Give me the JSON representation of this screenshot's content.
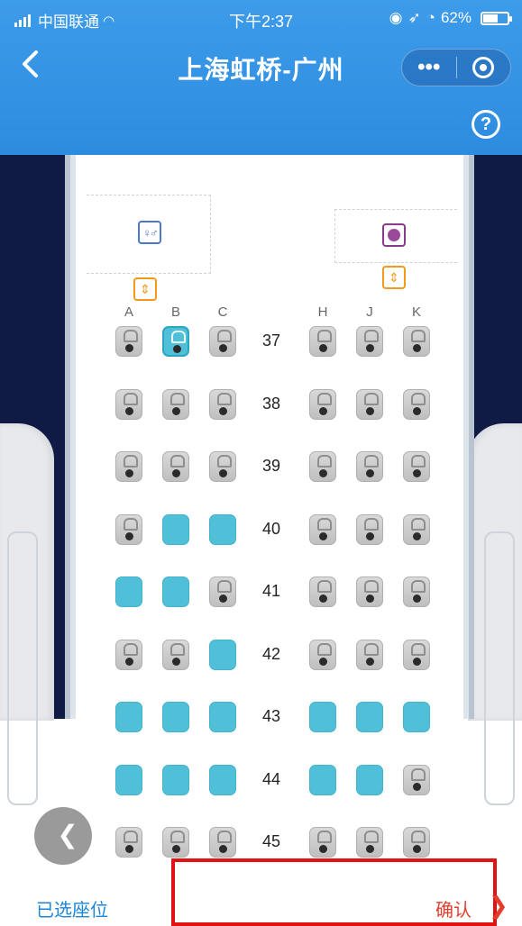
{
  "status_bar": {
    "carrier": "中国联通",
    "time": "下午2:37",
    "battery": "62%",
    "battery_level": 0.62
  },
  "nav": {
    "title": "上海虹桥-广州",
    "back_icon": "chevron-left-icon",
    "more_icon": "more-dots-icon",
    "close_icon": "target-ring-icon",
    "help_label": "?"
  },
  "cabin": {
    "seat_letters": [
      "A",
      "B",
      "C",
      "H",
      "J",
      "K"
    ],
    "rows": [
      {
        "number": "37",
        "seats": [
          "occupied",
          "selected",
          "occupied",
          "occupied",
          "occupied",
          "occupied"
        ]
      },
      {
        "number": "38",
        "seats": [
          "occupied",
          "occupied",
          "occupied",
          "occupied",
          "occupied",
          "occupied"
        ]
      },
      {
        "number": "39",
        "seats": [
          "occupied",
          "occupied",
          "occupied",
          "occupied",
          "occupied",
          "occupied"
        ]
      },
      {
        "number": "40",
        "seats": [
          "occupied",
          "available",
          "available",
          "occupied",
          "occupied",
          "occupied"
        ]
      },
      {
        "number": "41",
        "seats": [
          "available",
          "available",
          "occupied",
          "occupied",
          "occupied",
          "occupied"
        ]
      },
      {
        "number": "42",
        "seats": [
          "occupied",
          "occupied",
          "available",
          "occupied",
          "occupied",
          "occupied"
        ]
      },
      {
        "number": "43",
        "seats": [
          "available",
          "available",
          "available",
          "available",
          "available",
          "available"
        ]
      },
      {
        "number": "44",
        "seats": [
          "available",
          "available",
          "available",
          "available",
          "available",
          "occupied"
        ]
      },
      {
        "number": "45",
        "seats": [
          "occupied",
          "occupied",
          "occupied",
          "occupied",
          "occupied",
          "occupied"
        ]
      }
    ],
    "colors": {
      "available": "#50c0d8",
      "occupied": "#c8c8c8",
      "header": "#3d9bea",
      "cabin_bg": "#0f1b45"
    }
  },
  "bottom_bar": {
    "selected_label": "已选座位",
    "confirm_label": "确认",
    "confirm_arrow": "❯"
  }
}
